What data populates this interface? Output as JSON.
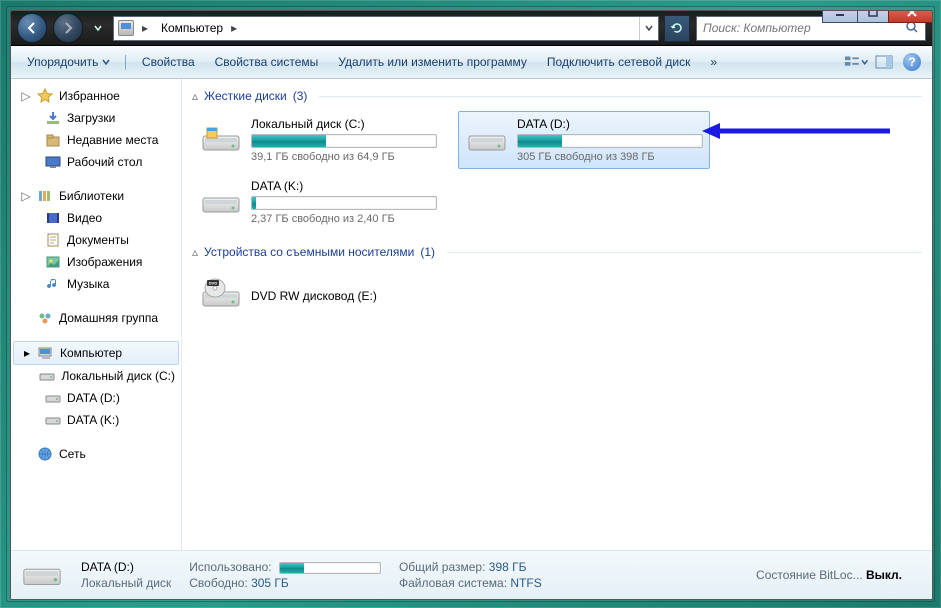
{
  "breadcrumb": {
    "root": "Компьютер"
  },
  "search": {
    "placeholder": "Поиск: Компьютер"
  },
  "toolbar": {
    "organize": "Упорядочить",
    "properties": "Свойства",
    "system_properties": "Свойства системы",
    "uninstall_change": "Удалить или изменить программу",
    "map_drive": "Подключить сетевой диск",
    "overflow": "»"
  },
  "sidebar": {
    "favorites": {
      "label": "Избранное",
      "items": [
        "Загрузки",
        "Недавние места",
        "Рабочий стол"
      ]
    },
    "libraries": {
      "label": "Библиотеки",
      "items": [
        "Видео",
        "Документы",
        "Изображения",
        "Музыка"
      ]
    },
    "homegroup": {
      "label": "Домашняя группа"
    },
    "computer": {
      "label": "Компьютер",
      "items": [
        "Локальный диск (C:)",
        "DATA (D:)",
        "DATA (K:)"
      ]
    },
    "network": {
      "label": "Сеть"
    }
  },
  "groups": {
    "hdd": {
      "label": "Жесткие диски",
      "count": "(3)"
    },
    "removable": {
      "label": "Устройства со съемными носителями",
      "count": "(1)"
    }
  },
  "drives": {
    "c": {
      "name": "Локальный диск (C:)",
      "free": "39,1 ГБ свободно из 64,9 ГБ",
      "fill": 40
    },
    "d": {
      "name": "DATA (D:)",
      "free": "305 ГБ свободно из 398 ГБ",
      "fill": 24
    },
    "k": {
      "name": "DATA (K:)",
      "free": "2,37 ГБ свободно из 2,40 ГБ",
      "fill": 2
    },
    "e": {
      "name": "DVD RW дисковод (E:)"
    }
  },
  "status": {
    "name": "DATA (D:)",
    "type": "Локальный диск",
    "used_label": "Использовано:",
    "free_label": "Свободно:",
    "free_val": "305 ГБ",
    "size_label": "Общий размер:",
    "size_val": "398 ГБ",
    "fs_label": "Файловая система:",
    "fs_val": "NTFS",
    "bitlocker_label": "Состояние BitLoc...",
    "bitlocker_val": "Выкл."
  },
  "colors": {
    "accent": "#1a9a9a",
    "link": "#1a3e9a"
  }
}
